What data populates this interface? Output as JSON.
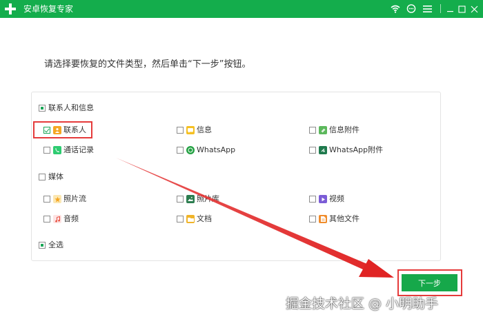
{
  "window": {
    "title": "安卓恢复专家"
  },
  "instruction": "请选择要恢复的文件类型，然后单击“下一步”按钮。",
  "categories": {
    "contacts_info": {
      "label": "联系人和信息",
      "state": "partial"
    },
    "media": {
      "label": "媒体",
      "state": "unchecked"
    },
    "select_all": {
      "label": "全选",
      "state": "partial"
    }
  },
  "items": {
    "contacts": {
      "label": "联系人",
      "checked": true
    },
    "messages": {
      "label": "信息",
      "checked": false
    },
    "message_attachments": {
      "label": "信息附件",
      "checked": false
    },
    "call_logs": {
      "label": "通话记录",
      "checked": false
    },
    "whatsapp": {
      "label": "WhatsApp",
      "checked": false
    },
    "whatsapp_attachments": {
      "label": "WhatsApp附件",
      "checked": false
    },
    "camera_roll": {
      "label": "照片流",
      "checked": false
    },
    "photo_library": {
      "label": "照片库",
      "checked": false
    },
    "video": {
      "label": "视频",
      "checked": false
    },
    "audio": {
      "label": "音频",
      "checked": false
    },
    "documents": {
      "label": "文档",
      "checked": false
    },
    "other_files": {
      "label": "其他文件",
      "checked": false
    }
  },
  "next_button": {
    "label": "下一步"
  },
  "watermark": "掘金技术社区 @ 小明助手",
  "colors": {
    "brand": "#14ad4c",
    "button": "#16a84a",
    "annotation": "#e53a3a"
  },
  "icons": {
    "title_bar": [
      "wifi-icon",
      "chat-icon",
      "menu-icon",
      "minimize-icon",
      "maximize-icon",
      "close-icon"
    ]
  }
}
